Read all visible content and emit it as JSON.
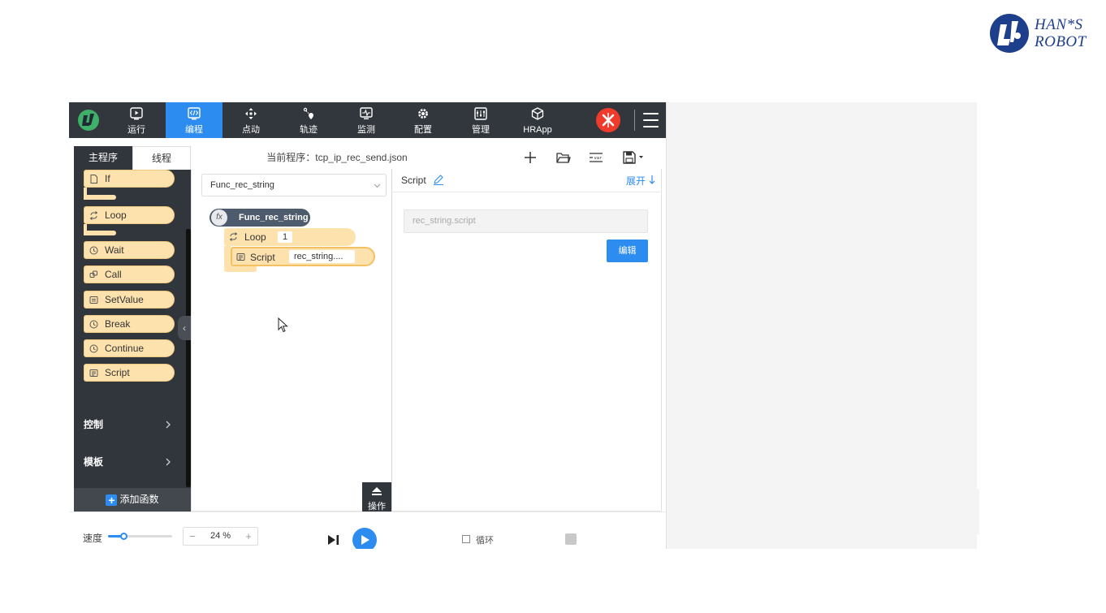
{
  "brand": {
    "line1": "HAN*S",
    "line2": "ROBOT"
  },
  "nav": {
    "items": [
      {
        "label": "运行",
        "icon": "play-screen-icon"
      },
      {
        "label": "编程",
        "icon": "code-screen-icon",
        "active": true
      },
      {
        "label": "点动",
        "icon": "move-arrows-icon"
      },
      {
        "label": "轨迹",
        "icon": "trajectory-icon"
      },
      {
        "label": "监测",
        "icon": "monitor-icon"
      },
      {
        "label": "配置",
        "icon": "config-gear-icon"
      },
      {
        "label": "管理",
        "icon": "manage-icon"
      },
      {
        "label": "HRApp",
        "icon": "cube-icon"
      }
    ]
  },
  "sidebar": {
    "tabs": [
      "主程序",
      "线程"
    ],
    "blocks": [
      "If",
      "Loop",
      "Wait",
      "Call",
      "SetValue",
      "Break",
      "Continue",
      "Script"
    ],
    "categories": [
      "控制",
      "模板"
    ],
    "add_function": "添加函数"
  },
  "toolbar": {
    "program_title": "当前程序：tcp_ip_rec_send.json"
  },
  "workspace": {
    "function_select": "Func_rec_string",
    "fx_label": "fx",
    "function_block": "Func_rec_string",
    "loop_label": "Loop",
    "loop_count": "1",
    "script_label": "Script",
    "script_value": "rec_string....",
    "ops_label": "操作"
  },
  "props": {
    "title": "Script",
    "expand": "展开",
    "script_placeholder": "rec_string.script",
    "edit_button": "编辑"
  },
  "bottom": {
    "speed_label": "速度",
    "speed_value": "24 %",
    "speed_fraction": 0.24,
    "minus": "−",
    "plus": "+",
    "loop_label": "循环"
  },
  "colors": {
    "nav_bg": "#32373d",
    "accent": "#2d8cf0",
    "block": "#fde2ae",
    "estop": "#ee3b2c"
  }
}
